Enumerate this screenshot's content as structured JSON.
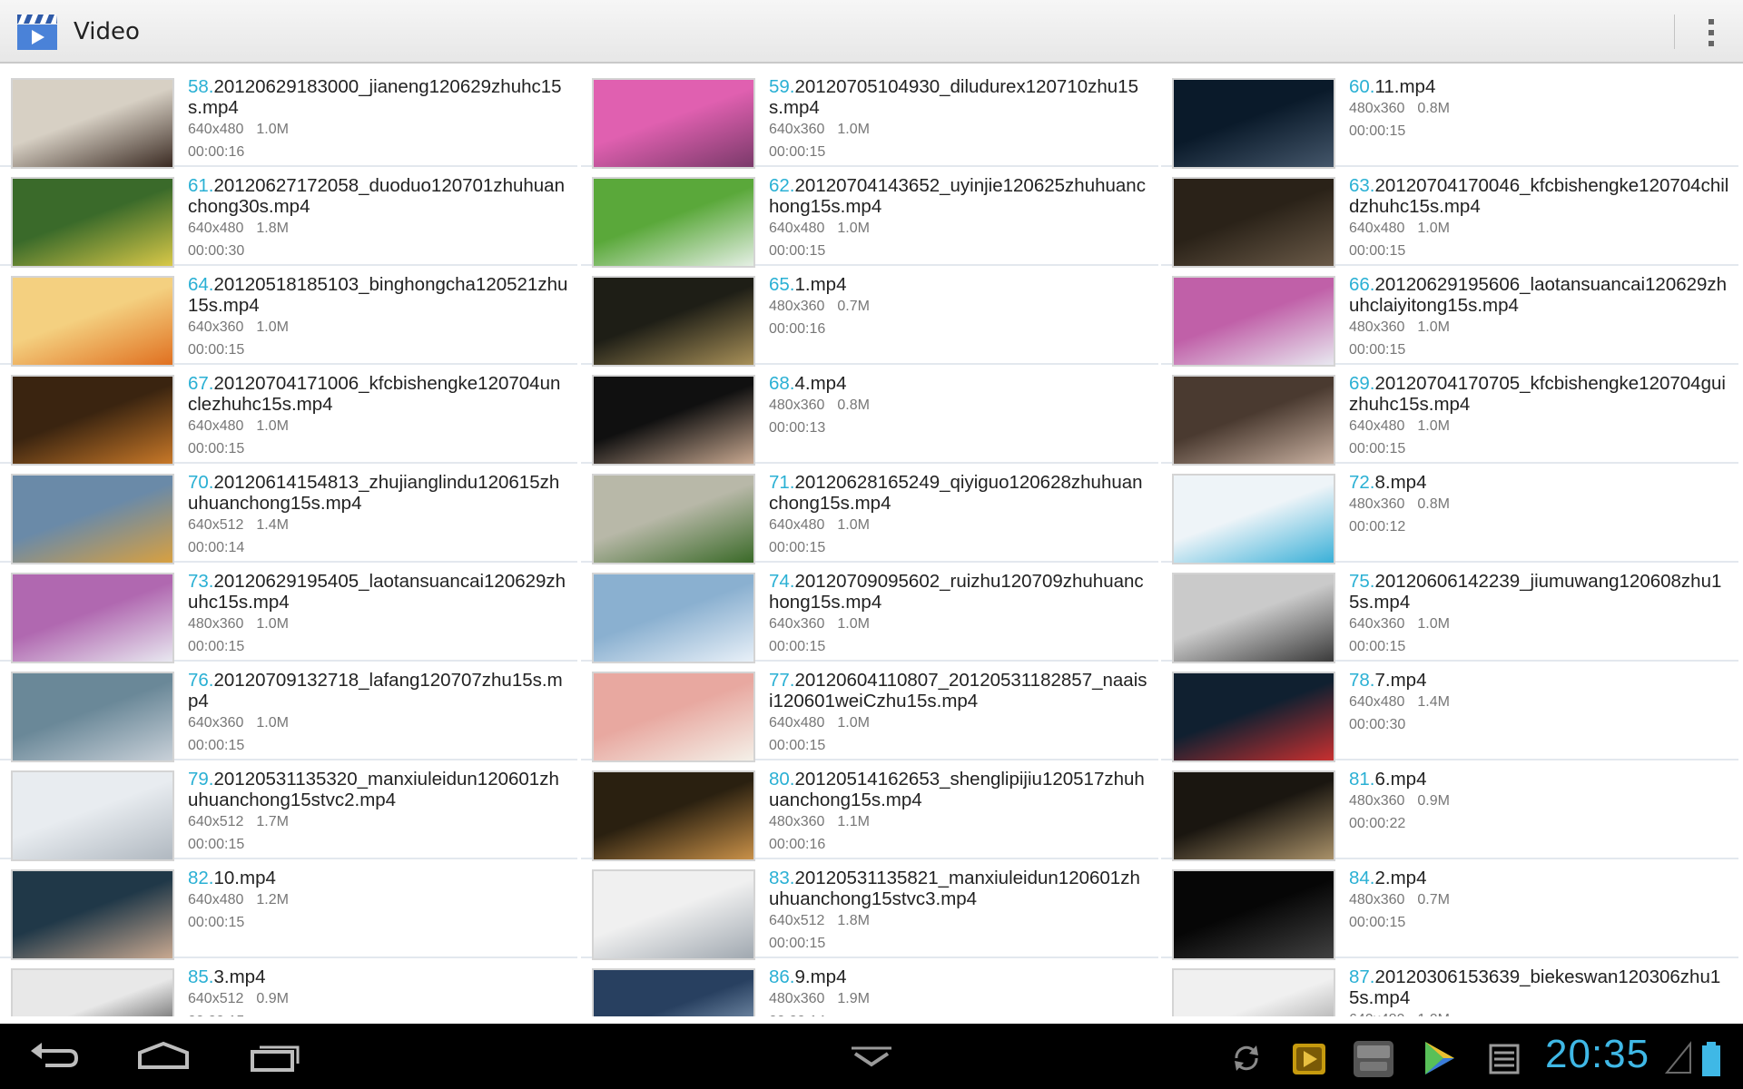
{
  "app": {
    "title": "Video",
    "icon": "clapperboard-play-icon"
  },
  "menu": {
    "icon": "overflow-menu-icon"
  },
  "videos": [
    {
      "num": "58.",
      "name": "20120629183000_jianeng120629zhuhc15s.mp4",
      "res": "640x480",
      "size": "1.0M",
      "dur": "00:00:16"
    },
    {
      "num": "59.",
      "name": "20120705104930_diludurex120710zhu15s.mp4",
      "res": "640x360",
      "size": "1.0M",
      "dur": "00:00:15"
    },
    {
      "num": "60.",
      "name": "11.mp4",
      "res": "480x360",
      "size": "0.8M",
      "dur": "00:00:15"
    },
    {
      "num": "61.",
      "name": "20120627172058_duoduo120701zhuhuanchong30s.mp4",
      "res": "640x480",
      "size": "1.8M",
      "dur": "00:00:30"
    },
    {
      "num": "62.",
      "name": "20120704143652_uyinjie120625zhuhuanchong15s.mp4",
      "res": "640x480",
      "size": "1.0M",
      "dur": "00:00:15"
    },
    {
      "num": "63.",
      "name": "20120704170046_kfcbishengke120704childzhuhc15s.mp4",
      "res": "640x480",
      "size": "1.0M",
      "dur": "00:00:15"
    },
    {
      "num": "64.",
      "name": "20120518185103_binghongcha120521zhu15s.mp4",
      "res": "640x360",
      "size": "1.0M",
      "dur": "00:00:15"
    },
    {
      "num": "65.",
      "name": "1.mp4",
      "res": "480x360",
      "size": "0.7M",
      "dur": "00:00:16"
    },
    {
      "num": "66.",
      "name": "20120629195606_laotansuancai120629zhuhclaiyitong15s.mp4",
      "res": "480x360",
      "size": "1.0M",
      "dur": "00:00:15"
    },
    {
      "num": "67.",
      "name": "20120704171006_kfcbishengke120704unclezhuhc15s.mp4",
      "res": "640x480",
      "size": "1.0M",
      "dur": "00:00:15"
    },
    {
      "num": "68.",
      "name": "4.mp4",
      "res": "480x360",
      "size": "0.8M",
      "dur": "00:00:13"
    },
    {
      "num": "69.",
      "name": "20120704170705_kfcbishengke120704guizhuhc15s.mp4",
      "res": "640x480",
      "size": "1.0M",
      "dur": "00:00:15"
    },
    {
      "num": "70.",
      "name": "20120614154813_zhujianglindu120615zhuhuanchong15s.mp4",
      "res": "640x512",
      "size": "1.4M",
      "dur": "00:00:14"
    },
    {
      "num": "71.",
      "name": "20120628165249_qiyiguo120628zhuhuanchong15s.mp4",
      "res": "640x480",
      "size": "1.0M",
      "dur": "00:00:15"
    },
    {
      "num": "72.",
      "name": "8.mp4",
      "res": "480x360",
      "size": "0.8M",
      "dur": "00:00:12"
    },
    {
      "num": "73.",
      "name": "20120629195405_laotansuancai120629zhuhc15s.mp4",
      "res": "480x360",
      "size": "1.0M",
      "dur": "00:00:15"
    },
    {
      "num": "74.",
      "name": "20120709095602_ruizhu120709zhuhuanchong15s.mp4",
      "res": "640x360",
      "size": "1.0M",
      "dur": "00:00:15"
    },
    {
      "num": "75.",
      "name": "20120606142239_jiumuwang120608zhu15s.mp4",
      "res": "640x360",
      "size": "1.0M",
      "dur": "00:00:15"
    },
    {
      "num": "76.",
      "name": "20120709132718_lafang120707zhu15s.mp4",
      "res": "640x360",
      "size": "1.0M",
      "dur": "00:00:15"
    },
    {
      "num": "77.",
      "name": "20120604110807_20120531182857_naaisi120601weiCzhu15s.mp4",
      "res": "640x480",
      "size": "1.0M",
      "dur": "00:00:15"
    },
    {
      "num": "78.",
      "name": "7.mp4",
      "res": "640x480",
      "size": "1.4M",
      "dur": "00:00:30"
    },
    {
      "num": "79.",
      "name": "20120531135320_manxiuleidun120601zhuhuanchong15stvc2.mp4",
      "res": "640x512",
      "size": "1.7M",
      "dur": "00:00:15"
    },
    {
      "num": "80.",
      "name": "20120514162653_shenglipijiu120517zhuhuanchong15s.mp4",
      "res": "480x360",
      "size": "1.1M",
      "dur": "00:00:16"
    },
    {
      "num": "81.",
      "name": "6.mp4",
      "res": "480x360",
      "size": "0.9M",
      "dur": "00:00:22"
    },
    {
      "num": "82.",
      "name": "10.mp4",
      "res": "640x480",
      "size": "1.2M",
      "dur": "00:00:15"
    },
    {
      "num": "83.",
      "name": "20120531135821_manxiuleidun120601zhuhuanchong15stvc3.mp4",
      "res": "640x512",
      "size": "1.8M",
      "dur": "00:00:15"
    },
    {
      "num": "84.",
      "name": "2.mp4",
      "res": "480x360",
      "size": "0.7M",
      "dur": "00:00:15"
    },
    {
      "num": "85.",
      "name": "3.mp4",
      "res": "640x512",
      "size": "0.9M",
      "dur": "00:00:15"
    },
    {
      "num": "86.",
      "name": "9.mp4",
      "res": "480x360",
      "size": "1.9M",
      "dur": "00:00:14"
    },
    {
      "num": "87.",
      "name": "20120306153639_biekeswan120306zhu15s.mp4",
      "res": "640x480",
      "size": "1.0M",
      "dur": "00:00:15"
    }
  ],
  "thumb_colors": [
    [
      "#d7d0c4",
      "#3a2a22"
    ],
    [
      "#e060b0",
      "#7a3a6a"
    ],
    [
      "#0a1a2a",
      "#44566a"
    ],
    [
      "#3a6a2a",
      "#d8c848"
    ],
    [
      "#5aa83a",
      "#e4efe4"
    ],
    [
      "#2a2218",
      "#6a5a48"
    ],
    [
      "#f4d080",
      "#e07020"
    ],
    [
      "#1e1e16",
      "#a89058"
    ],
    [
      "#c060a8",
      "#e8e8f0"
    ],
    [
      "#3a2410",
      "#c87828"
    ],
    [
      "#101010",
      "#c8a890"
    ],
    [
      "#4a3a30",
      "#c8b0a0"
    ],
    [
      "#6a8aa8",
      "#d8a040"
    ],
    [
      "#b8b8a8",
      "#3a6a28"
    ],
    [
      "#eef4f8",
      "#3ab0d8"
    ],
    [
      "#b068b0",
      "#e8e8f0"
    ],
    [
      "#8ab0d0",
      "#e8f0f8"
    ],
    [
      "#cacaca",
      "#3a3a3a"
    ],
    [
      "#6a8898",
      "#c8d0d8"
    ],
    [
      "#e8a8a0",
      "#f4f0e8"
    ],
    [
      "#102030",
      "#c83030"
    ],
    [
      "#e8ecf0",
      "#b0b8c0"
    ],
    [
      "#2a2010",
      "#c89048"
    ],
    [
      "#1a1610",
      "#a89068"
    ],
    [
      "#203848",
      "#c8a890"
    ],
    [
      "#f0f0f0",
      "#a0a8b0"
    ],
    [
      "#060606",
      "#404040"
    ],
    [
      "#e8e8e8",
      "#1a1a1a"
    ],
    [
      "#284060",
      "#a8c0d8"
    ],
    [
      "#f0f0f0",
      "#888888"
    ]
  ],
  "status": {
    "time": "20:35"
  },
  "nav": {
    "back_icon": "back-icon",
    "home_icon": "home-icon",
    "recents_icon": "recent-apps-icon",
    "hide_icon": "hide-keyboard-icon"
  }
}
